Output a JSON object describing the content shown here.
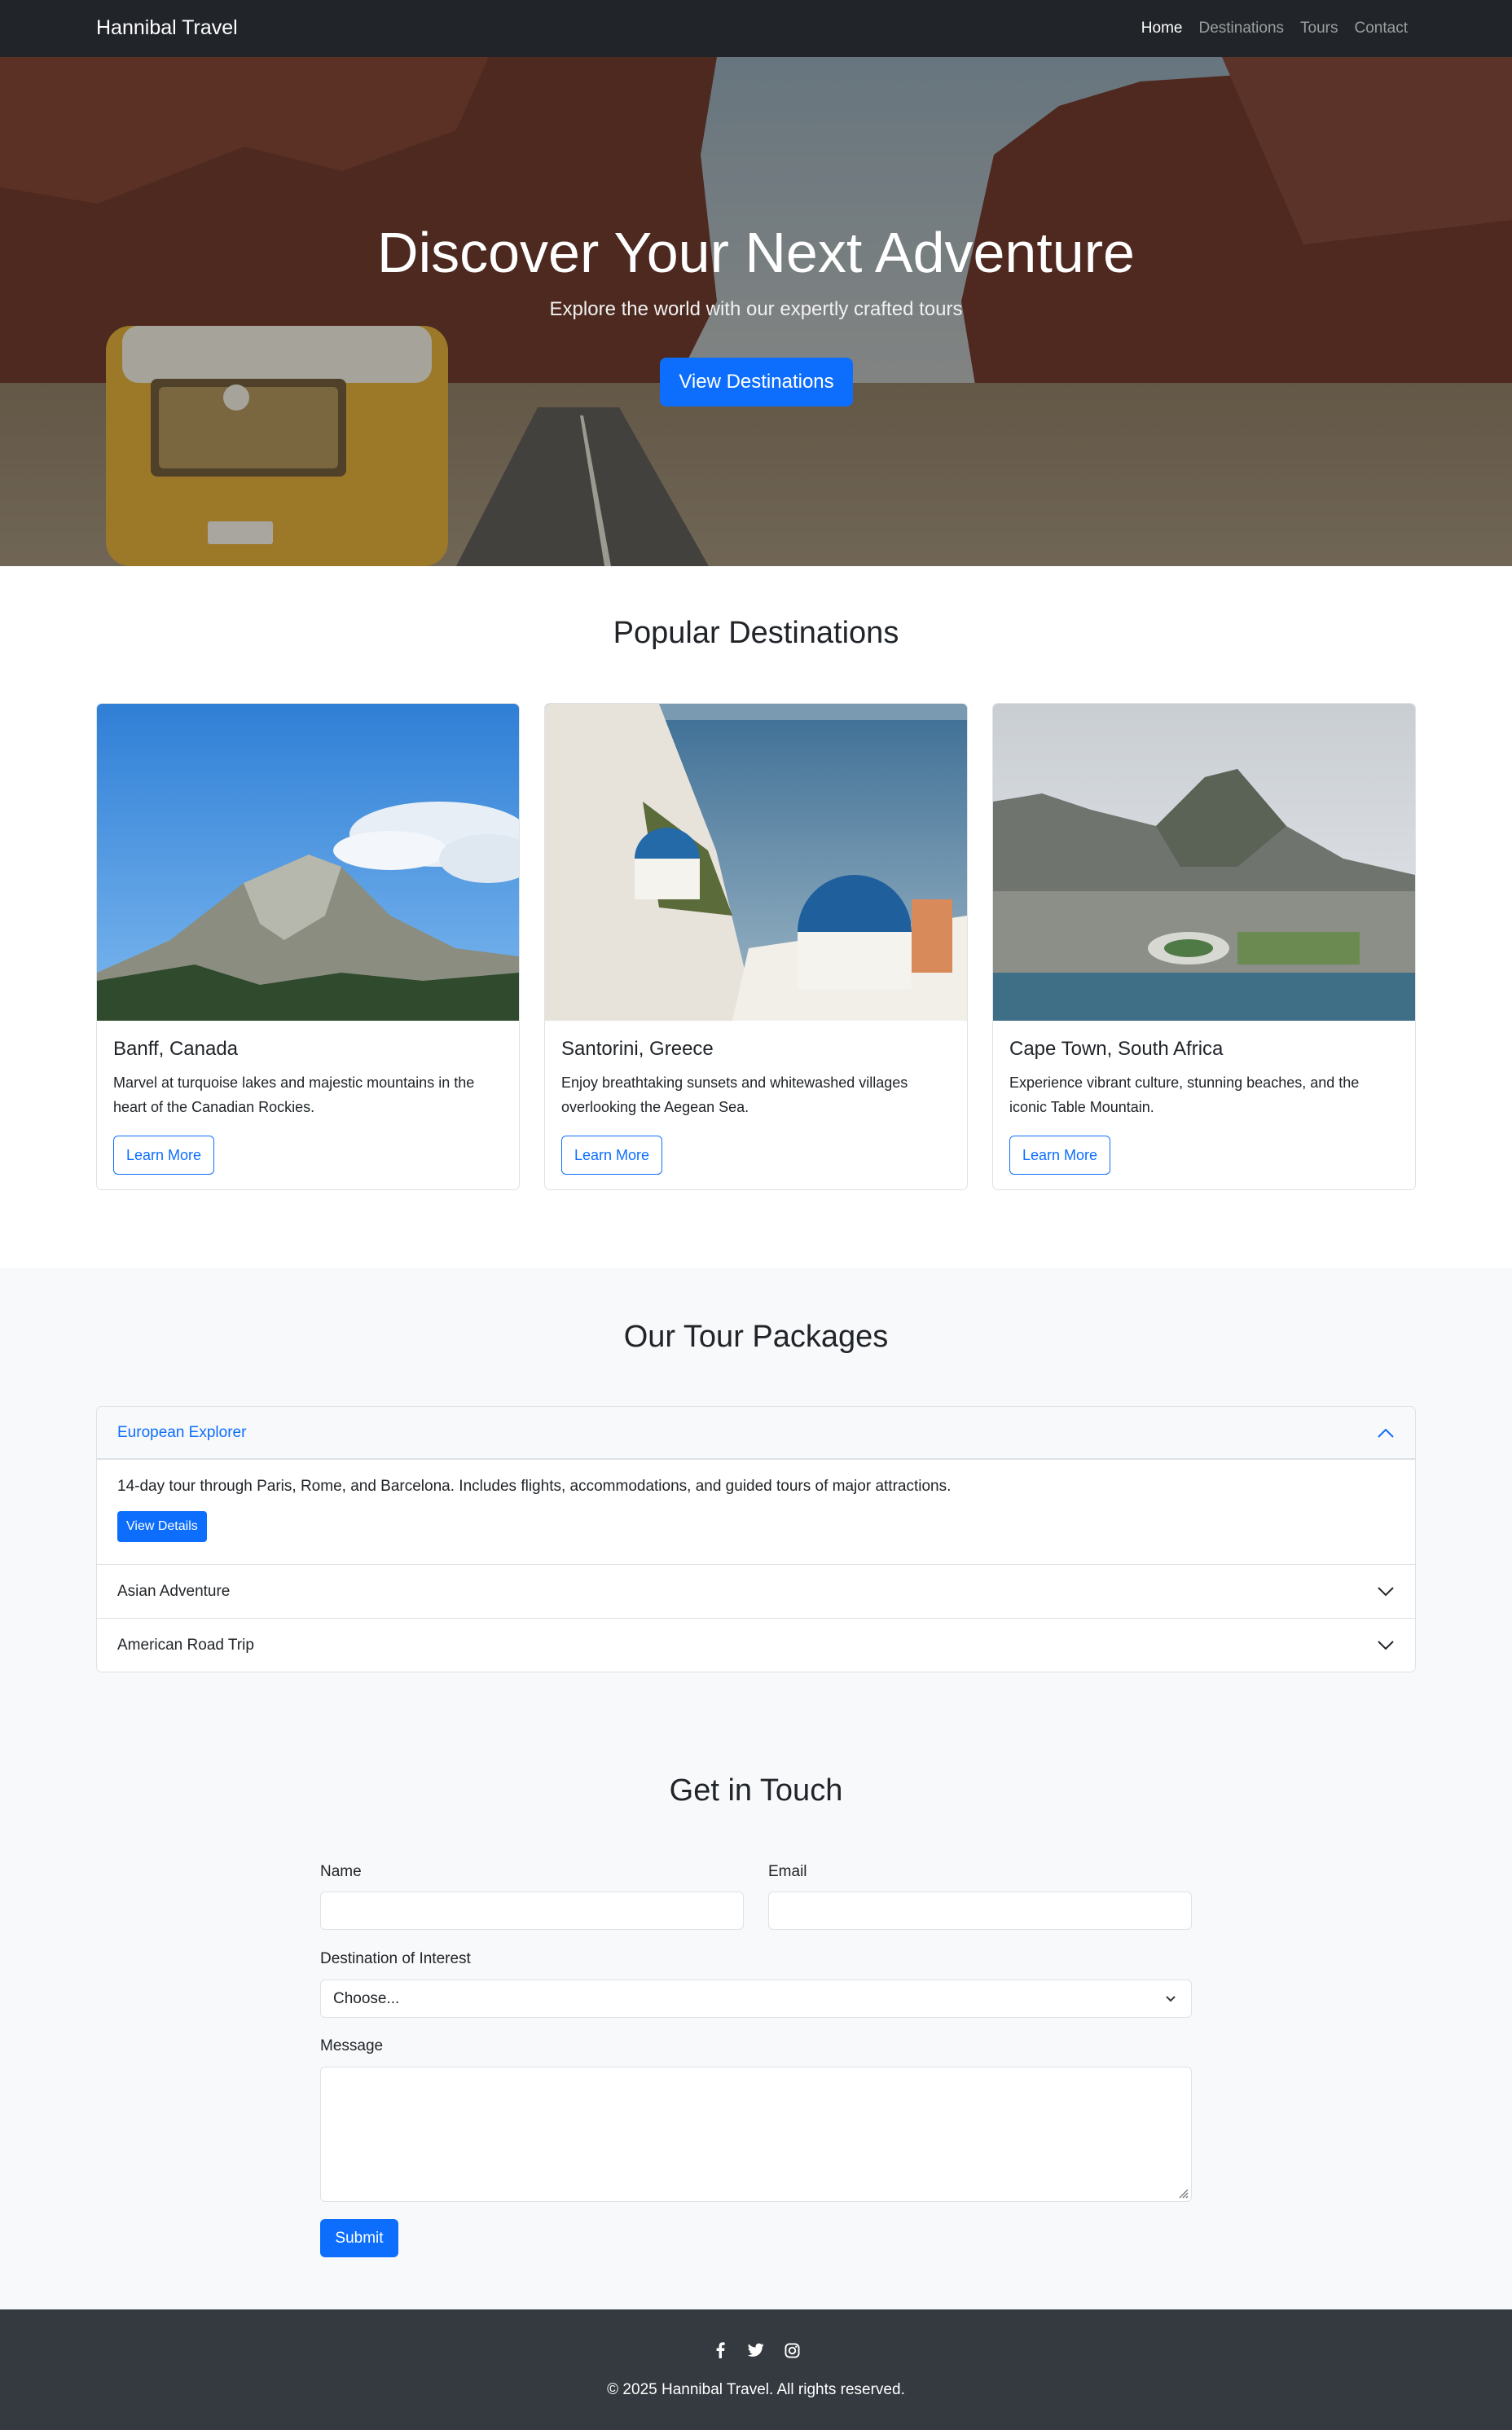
{
  "navbar": {
    "brand": "Hannibal Travel",
    "links": [
      {
        "label": "Home",
        "active": true
      },
      {
        "label": "Destinations",
        "active": false
      },
      {
        "label": "Tours",
        "active": false
      },
      {
        "label": "Contact",
        "active": false
      }
    ]
  },
  "hero": {
    "title": "Discover Your Next Adventure",
    "subtitle": "Explore the world with our expertly crafted tours",
    "cta": "View Destinations"
  },
  "destinations": {
    "title": "Popular Destinations",
    "cards": [
      {
        "title": "Banff, Canada",
        "text": "Marvel at turquoise lakes and majestic mountains in the heart of the Canadian Rockies.",
        "button": "Learn More"
      },
      {
        "title": "Santorini, Greece",
        "text": "Enjoy breathtaking sunsets and whitewashed villages overlooking the Aegean Sea.",
        "button": "Learn More"
      },
      {
        "title": "Cape Town, South Africa",
        "text": "Experience vibrant culture, stunning beaches, and the iconic Table Mountain.",
        "button": "Learn More"
      }
    ]
  },
  "tours": {
    "title": "Our Tour Packages",
    "items": [
      {
        "label": "European Explorer",
        "open": true,
        "body": "14-day tour through Paris, Rome, and Barcelona. Includes flights, accommodations, and guided tours of major attractions.",
        "button": "View Details"
      },
      {
        "label": "Asian Adventure",
        "open": false
      },
      {
        "label": "American Road Trip",
        "open": false
      }
    ]
  },
  "contact": {
    "title": "Get in Touch",
    "name_label": "Name",
    "email_label": "Email",
    "destination_label": "Destination of Interest",
    "destination_value": "Choose...",
    "message_label": "Message",
    "submit": "Submit"
  },
  "footer": {
    "icons": [
      "facebook-icon",
      "twitter-icon",
      "instagram-icon"
    ],
    "copyright": "© 2025 Hannibal Travel. All rights reserved."
  },
  "colors": {
    "accent": "#0d6efd",
    "navbar": "#212529",
    "footer": "#343a40",
    "section_bg": "#f8f9fa"
  }
}
